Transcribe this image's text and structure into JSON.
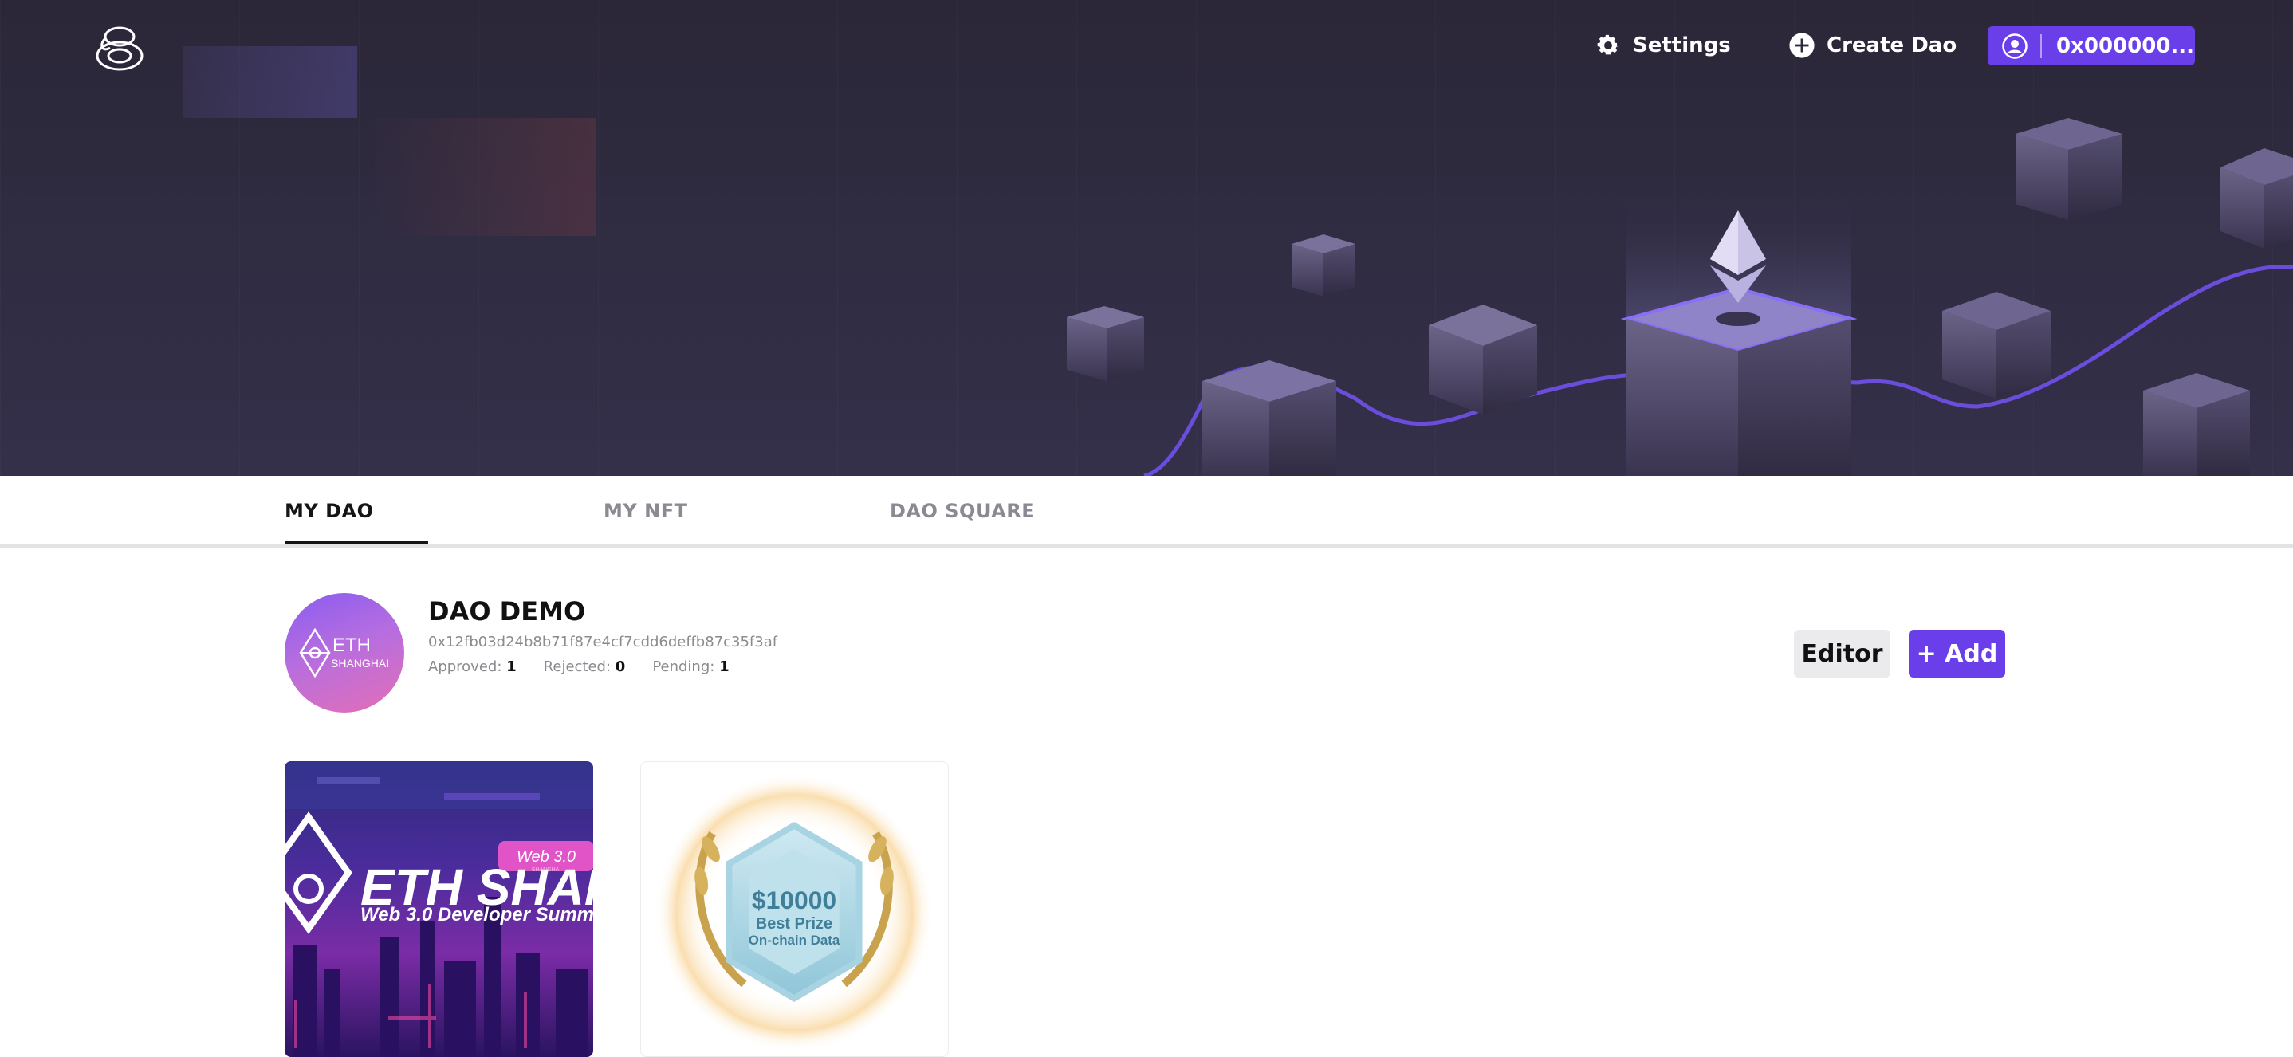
{
  "header": {
    "settings_label": "Settings",
    "create_dao_label": "Create Dao",
    "wallet_label": "0x000000..."
  },
  "tabs": [
    {
      "label": "MY DAO",
      "active": true
    },
    {
      "label": "MY NFT",
      "active": false
    },
    {
      "label": "DAO SQUARE",
      "active": false
    }
  ],
  "dao": {
    "name": "DAO DEMO",
    "address": "0x12fb03d24b8b71f87e4cf7cdd6deffb87c35f3af",
    "avatar_text": "ETH",
    "avatar_subtext": "SHANGHAI",
    "approved_label": "Approved:",
    "approved": "1",
    "rejected_label": "Rejected:",
    "rejected": "0",
    "pending_label": "Pending:",
    "pending": "1"
  },
  "actions": {
    "editor_label": "Editor",
    "add_label": "+ Add"
  },
  "cards": [
    {
      "title": "ETH SHANGHAI",
      "tag": "Web 3.0",
      "tag_sub": "SHANGHAI",
      "subtitle": "Web 3.0 Developer Summ"
    },
    {
      "line1": "$10000",
      "line2": "Best Prize",
      "line3": "On-chain Data"
    }
  ],
  "colors": {
    "accent": "#6a3fea",
    "hero_bg": "#2e2a3d"
  }
}
